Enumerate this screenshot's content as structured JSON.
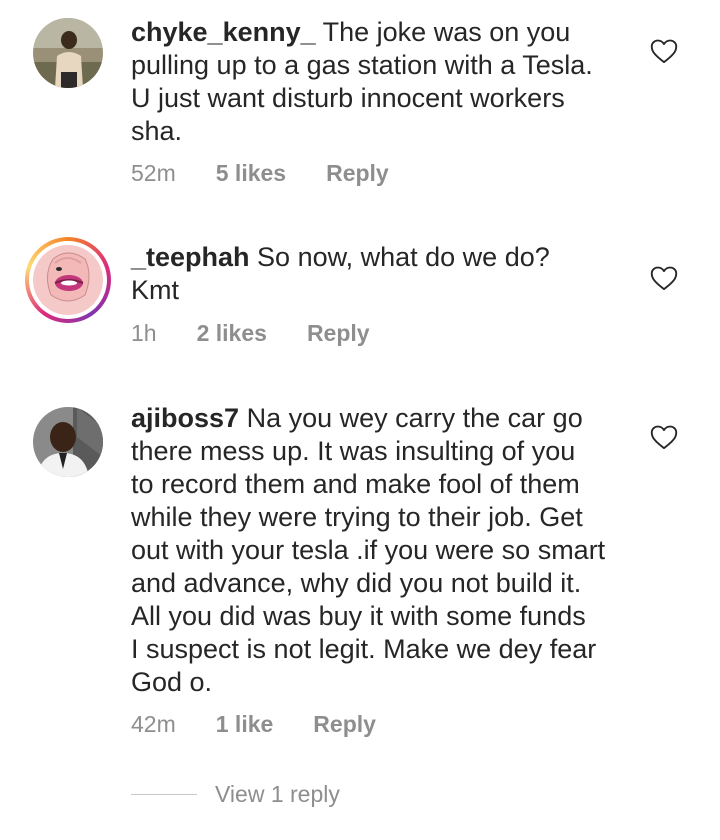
{
  "comments": [
    {
      "username": "chyke_kenny_",
      "text": " The joke was on you\npulling up to a gas station with a Tesla.\nU just want disturb innocent workers\nsha.",
      "time": "52m",
      "likes": "5 likes",
      "reply": "Reply",
      "avatar_icon": "user-photo-avatar",
      "like_icon": "heart-outline-icon"
    },
    {
      "username": "_teephah",
      "text": " So now, what do we do?\nKmt",
      "time": "1h",
      "likes": "2 likes",
      "reply": "Reply",
      "avatar_icon": "cartoon-lips-avatar",
      "like_icon": "heart-outline-icon",
      "has_story": true
    },
    {
      "username": "ajiboss7",
      "text": " Na you wey carry the car go\nthere mess up. It was insulting of you\nto record them and make fool of them\nwhile they were trying to their job. Get\nout with your tesla .if you were so smart\nand advance, why did you not build it.\nAll you did was buy it with some funds\nI suspect is not legit. Make we dey fear\nGod o.",
      "time": "42m",
      "likes": "1 like",
      "reply": "Reply",
      "avatar_icon": "user-photo-avatar",
      "like_icon": "heart-outline-icon"
    }
  ],
  "view_replies": "View 1 reply",
  "colors": {
    "text": "#262626",
    "meta": "#8e8e8e",
    "divider": "#c7c7c7",
    "story_ring": [
      "#f58529",
      "#dd2a7b",
      "#8134af"
    ]
  }
}
